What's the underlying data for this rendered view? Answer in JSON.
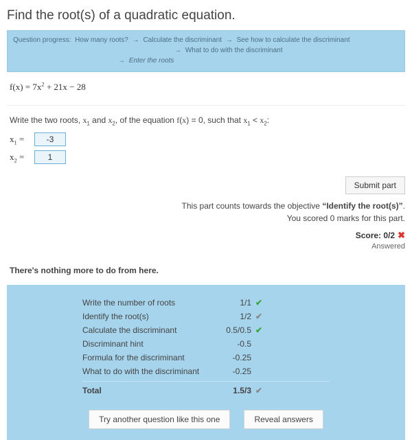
{
  "title": "Find the root(s) of a quadratic equation.",
  "progress": {
    "label": "Question progress:",
    "steps": [
      "How many roots?",
      "Calculate the discriminant",
      "See how to calculate the discriminant",
      "What to do with the discriminant",
      "Enter the roots"
    ]
  },
  "equation": {
    "lhs": "f(x)",
    "rhs_raw": "7x² + 21x − 28"
  },
  "prompt": {
    "pre": "Write the two roots, ",
    "x1": "x₁",
    "and": " and ",
    "x2": "x₂",
    "mid": ", of the equation ",
    "eq": "f(x) = 0",
    "rel": ", such that ",
    "cond": "x₁ < x₂",
    "end": ":"
  },
  "inputs": {
    "x1": {
      "label": "x₁ =",
      "value": "-3"
    },
    "x2": {
      "label": "x₂ =",
      "value": "1"
    }
  },
  "submit_label": "Submit part",
  "feedback": {
    "line1_pre": "This part counts towards the objective ",
    "line1_obj": "“Identify the root(s)”",
    "line1_post": ".",
    "line2": "You scored 0 marks for this part."
  },
  "score": {
    "label": "Score:",
    "value": "0/2"
  },
  "answered_label": "Answered",
  "nothing_more": "There's nothing more to do from here.",
  "summary": {
    "rows": [
      {
        "name": "Write the number of roots",
        "score": "1/1",
        "icon": "green"
      },
      {
        "name": "Identify the root(s)",
        "score": "1/2",
        "icon": "grey"
      },
      {
        "name": "Calculate the discriminant",
        "score": "0.5/0.5",
        "icon": "green"
      },
      {
        "name": "Discriminant hint",
        "score": "-0.5",
        "icon": ""
      },
      {
        "name": "Formula for the discriminant",
        "score": "-0.25",
        "icon": ""
      },
      {
        "name": "What to do with the discriminant",
        "score": "-0.25",
        "icon": ""
      }
    ],
    "total": {
      "name": "Total",
      "score": "1.5/3",
      "icon": "grey"
    }
  },
  "buttons": {
    "try_another": "Try another question like this one",
    "reveal": "Reveal answers"
  }
}
